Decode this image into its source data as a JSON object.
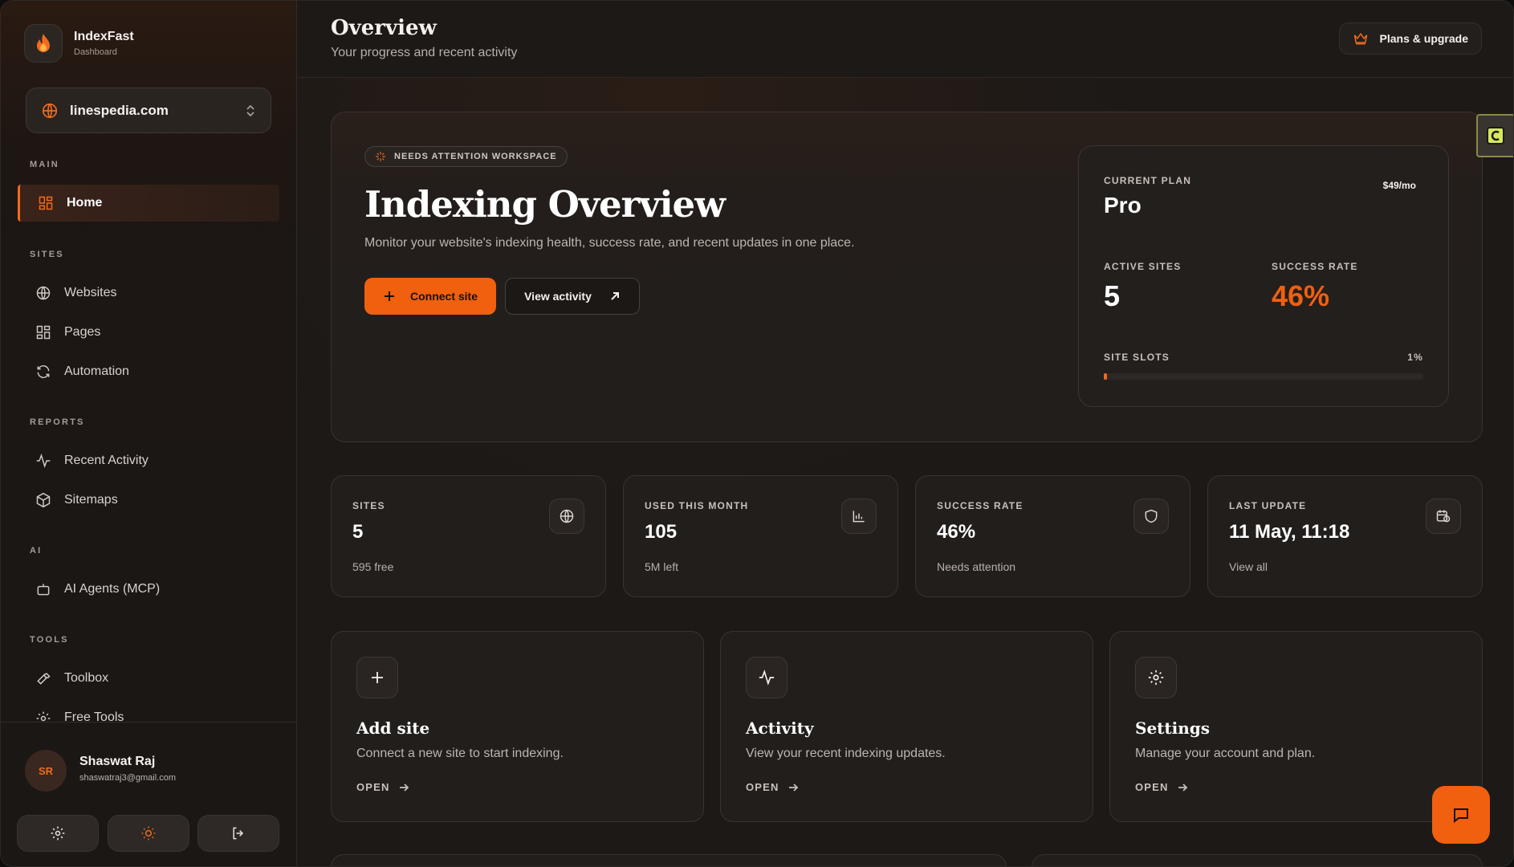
{
  "brand": {
    "name": "IndexFast",
    "subtitle": "Dashboard"
  },
  "site_selector": {
    "value": "linespedia.com"
  },
  "sidebar": {
    "sections": {
      "main": "MAIN",
      "sites": "SITES",
      "reports": "REPORTS",
      "ai": "AI",
      "tools": "TOOLS"
    },
    "items": {
      "home": "Home",
      "websites": "Websites",
      "pages": "Pages",
      "automation": "Automation",
      "recent_activity": "Recent Activity",
      "sitemaps": "Sitemaps",
      "ai_agents": "AI Agents (MCP)",
      "toolbox": "Toolbox",
      "free_tools": "Free Tools"
    }
  },
  "user": {
    "initials": "SR",
    "name": "Shaswat Raj",
    "email": "shaswatraj3@gmail.com"
  },
  "header": {
    "title": "Overview",
    "subtitle": "Your progress and recent activity",
    "upgrade_label": "Plans & upgrade"
  },
  "hero": {
    "badge": "NEEDS ATTENTION WORKSPACE",
    "title": "Indexing Overview",
    "description": "Monitor your website's indexing health, success rate, and recent updates in one place.",
    "primary_button": "Connect site",
    "secondary_button": "View activity"
  },
  "plan": {
    "label": "CURRENT PLAN",
    "price": "$49/mo",
    "name": "Pro",
    "active_sites_label": "ACTIVE SITES",
    "active_sites_value": "5",
    "success_rate_label": "SUCCESS RATE",
    "success_rate_value": "46%",
    "site_slots_label": "SITE SLOTS",
    "site_slots_value": "1%",
    "site_slots_fraction": 0.01
  },
  "stats": [
    {
      "label": "SITES",
      "value": "5",
      "sub": "595 free",
      "icon": "globe-icon"
    },
    {
      "label": "USED THIS MONTH",
      "value": "105",
      "sub": "5M left",
      "icon": "bar-chart-icon"
    },
    {
      "label": "SUCCESS RATE",
      "value": "46%",
      "sub": "Needs attention",
      "icon": "shield-icon"
    },
    {
      "label": "LAST UPDATE",
      "value": "11 May, 11:18",
      "sub": "View all",
      "icon": "calendar-clock-icon"
    }
  ],
  "actions": [
    {
      "title": "Add site",
      "description": "Connect a new site to start indexing.",
      "open": "OPEN",
      "icon": "plus-icon"
    },
    {
      "title": "Activity",
      "description": "View your recent indexing updates.",
      "open": "OPEN",
      "icon": "activity-icon"
    },
    {
      "title": "Settings",
      "description": "Manage your account and plan.",
      "open": "OPEN",
      "icon": "gear-icon"
    }
  ],
  "colors": {
    "accent": "#f0600f",
    "background": "#1c1917",
    "card": "#221e1c"
  }
}
